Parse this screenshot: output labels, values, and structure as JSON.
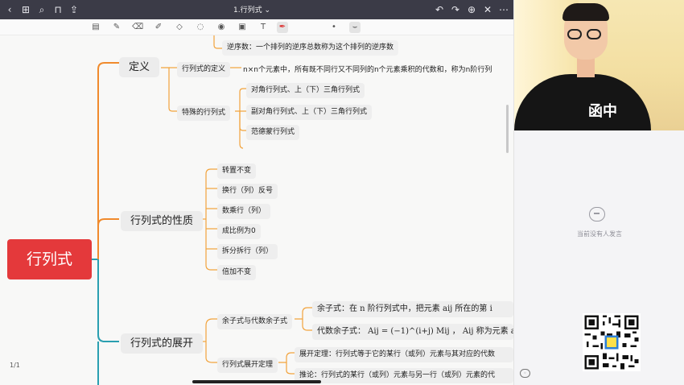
{
  "window": {
    "title": "1.行列式",
    "title_suffix": "⌄"
  },
  "toolbar": {
    "tools": [
      "layout-icon",
      "pen-icon",
      "eraser-icon",
      "highlighter-icon",
      "shapes-icon",
      "lasso-icon",
      "eye-icon",
      "image-icon",
      "text-icon",
      "laser-pointer-icon",
      "dot-icon",
      "stroke-icon"
    ]
  },
  "mindmap": {
    "root": "行列式",
    "branches": {
      "definition": {
        "label": "定义",
        "top_item": "逆序数：一个排列的逆序总数称为这个排列的逆序数",
        "det_def_label": "行列式的定义",
        "det_def_text": "n×n个元素中，所有既不同行又不同列的n个元素乘积的代数和，称为n阶行列",
        "special_label": "特殊的行列式",
        "special_items": [
          "对角行列式、上（下）三角行列式",
          "副对角行列式、上（下）三角行列式",
          "范德蒙行列式"
        ]
      },
      "properties": {
        "label": "行列式的性质",
        "items": [
          "转置不变",
          "换行（列）反号",
          "数乘行（列）",
          "成比例为0",
          "拆分拆行（列）",
          "倍加不变"
        ]
      },
      "expansion": {
        "label": "行列式的展开",
        "cofactor_label": "余子式与代数余子式",
        "minor_text": "余子式：在 n 阶行列式中，把元素 aij 所在的第 i",
        "algebraic_text": "代数余子式：  Aij = (−1)^(i+j) Mij ，  Aij 称为元素 ai",
        "theorem_label": "行列式展开定理",
        "theorem_text": "展开定理：行列式等于它的某行（或列）元素与其对应的代数",
        "corollary_text": "推论：行列式的某行（或列）元素与另一行（或列）元素的代"
      }
    }
  },
  "page_indicator": "1/1",
  "right_panel": {
    "empty_comment_text": "当前没有人发言",
    "video_logo": "函中"
  },
  "colors": {
    "root": "#e4393b",
    "orange_branch": "#f08a2c",
    "teal_branch": "#2a9fb0",
    "topbar": "#3b3b47"
  }
}
